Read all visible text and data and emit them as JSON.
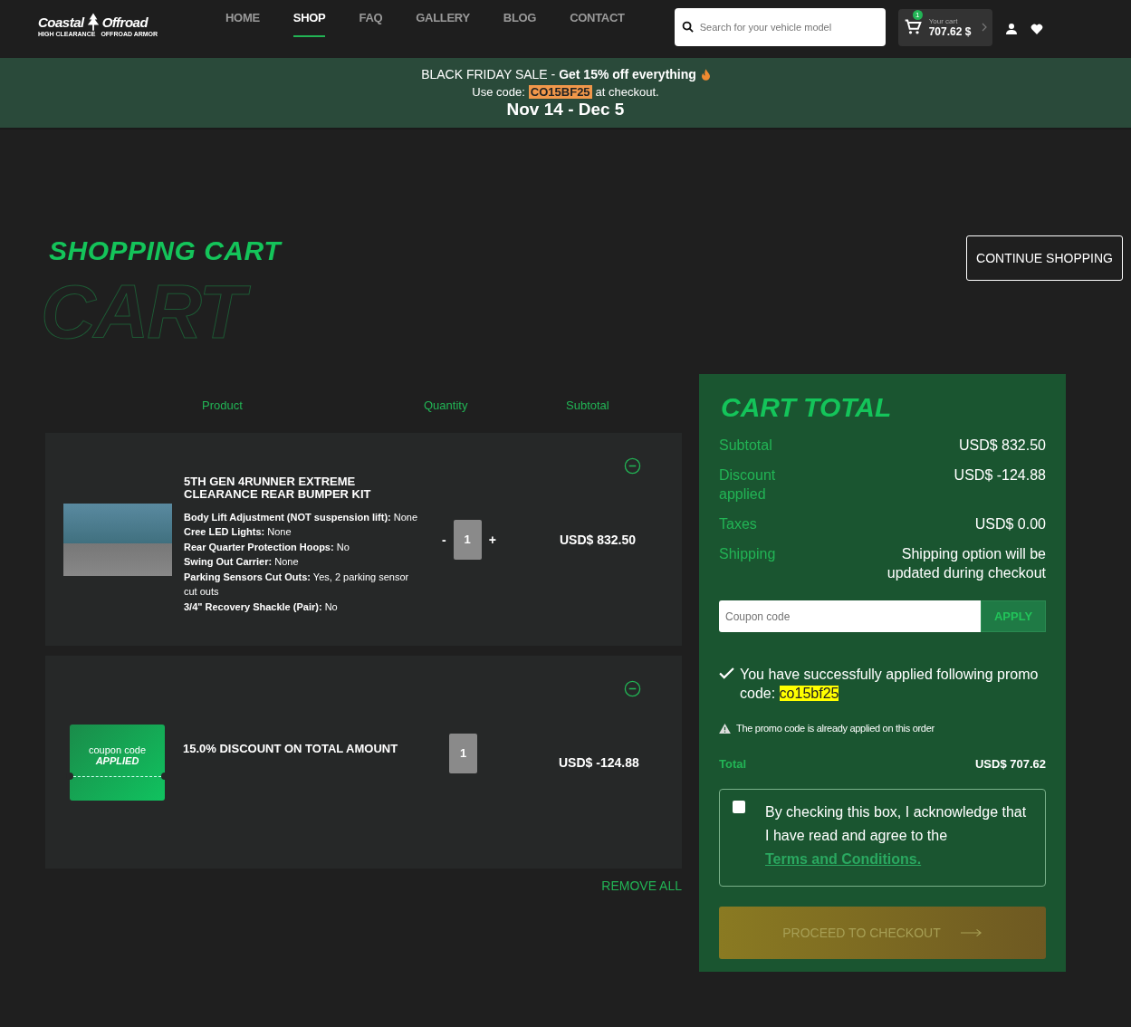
{
  "header": {
    "logo": {
      "name_left": "Coastal",
      "name_right": "Offroad",
      "tagline_left": "HIGH CLEARANCE",
      "tagline_right": "OFFROAD ARMOR"
    },
    "nav": [
      {
        "label": "HOME",
        "selected": false
      },
      {
        "label": "SHOP",
        "selected": true
      },
      {
        "label": "FAQ",
        "selected": false
      },
      {
        "label": "GALLERY",
        "selected": false
      },
      {
        "label": "BLOG",
        "selected": false
      },
      {
        "label": "CONTACT",
        "selected": false
      }
    ],
    "search": {
      "placeholder": "Search for your vehicle model"
    },
    "cart": {
      "count": "1",
      "label": "Your cart",
      "amount": "707.62 $"
    }
  },
  "banner": {
    "headline": "BLACK FRIDAY SALE - **Get 15% off everything**",
    "code_prefix": "Use code:",
    "code": "CO15BF25",
    "code_suffix": "at checkout.",
    "dates": "Nov 14 - Dec 5"
  },
  "page": {
    "title": "SHOPPING CART",
    "backdrop_word": "CART",
    "continue_button": "CONTINUE SHOPPING"
  },
  "columns": [
    "Product",
    "Quantity",
    "Subtotal"
  ],
  "items": [
    {
      "kind": "product",
      "name": "5TH GEN 4RUNNER EXTREME CLEARANCE REAR BUMPER KIT",
      "options": [
        {
          "label": "Body Lift Adjustment (NOT suspension lift):",
          "value": "None"
        },
        {
          "label": "Cree LED Lights:",
          "value": "None"
        },
        {
          "label": "Rear Quarter Protection Hoops:",
          "value": "No"
        },
        {
          "label": "Swing Out Carrier:",
          "value": "None"
        },
        {
          "label": "Parking Sensors Cut Outs:",
          "value": "Yes, 2 parking sensor cut outs"
        },
        {
          "label": "3/4\" Recovery Shackle (Pair):",
          "value": "No"
        }
      ],
      "minus": "-",
      "quantity": "1",
      "plus": "+",
      "subtotal": "USD$ 832.50"
    },
    {
      "kind": "coupon",
      "coupon_line1": "coupon code",
      "coupon_line2": "APPLIED",
      "name": "15.0% DISCOUNT ON TOTAL AMOUNT",
      "quantity": "1",
      "subtotal": "USD$ -124.88"
    }
  ],
  "remove_all": "REMOVE ALL",
  "totals": {
    "title": "CART TOTAL",
    "rows": [
      {
        "label": "Subtotal",
        "value": "USD$ 832.50"
      },
      {
        "label": "Discount applied",
        "value": "USD$ -124.88"
      },
      {
        "label": "Taxes",
        "value": "USD$ 0.00"
      },
      {
        "label": "Shipping",
        "value": "Shipping option will be updated during checkout"
      }
    ],
    "coupon": {
      "placeholder": "Coupon code",
      "button": "APPLY"
    },
    "success": {
      "text": "You have successfully applied following promo code:",
      "code": "co15bf25"
    },
    "warning": "The promo code is already applied on this order",
    "total": {
      "label": "Total",
      "value": "USD$ 707.62"
    },
    "terms": {
      "checked": false,
      "text": "By checking this box, I acknowledge that I have read and agree to the",
      "link": "Terms and Conditions."
    },
    "checkout": {
      "label": "PROCEED TO CHECKOUT",
      "disabled": true
    }
  }
}
